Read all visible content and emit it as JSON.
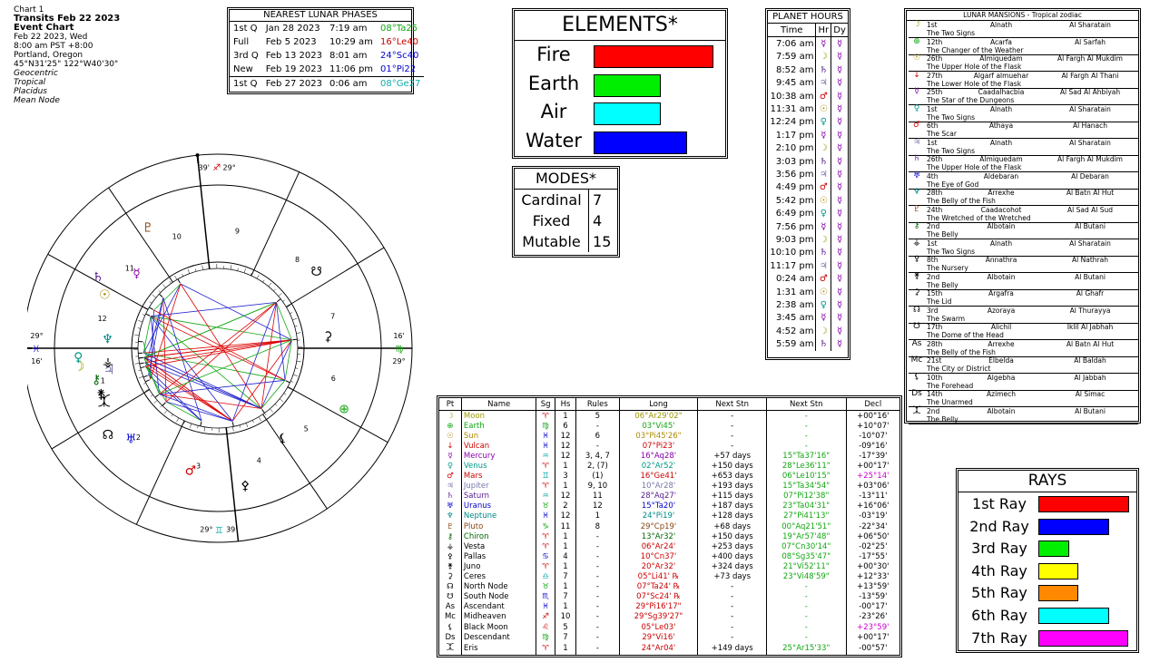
{
  "header": {
    "line1": "Chart 1",
    "title": "Transits Feb 22 2023",
    "subtitle": "Event Chart",
    "date": "Feb 22 2023, Wed",
    "time": "8:00 am  PST +8:00",
    "place": "Portland, Oregon",
    "coords": "45°N31'25\" 122°W40'30\"",
    "opt1": "Geocentric",
    "opt2": "Tropical",
    "opt3": "Placidus",
    "opt4": "Mean Node"
  },
  "phases": {
    "title": "NEAREST LUNAR PHASES",
    "rows": [
      {
        "phase": "1st Q",
        "date": "Jan 28 2023",
        "time": "7:19 am",
        "pos": "08°Ta25",
        "color": "#11a711"
      },
      {
        "phase": "Full",
        "date": "Feb 5 2023",
        "time": "10:29 am",
        "pos": "16°Le40",
        "color": "#cc0000"
      },
      {
        "phase": "3rd Q",
        "date": "Feb 13 2023",
        "time": "8:01 am",
        "pos": "24°Sc40",
        "color": "#0000cc"
      },
      {
        "phase": "New",
        "date": "Feb 19 2023",
        "time": "11:06 pm",
        "pos": "01°Pi22",
        "color": "#0000cc"
      },
      {
        "phase": "1st Q",
        "date": "Feb 27 2023",
        "time": "0:06 am",
        "pos": "08°Ge27",
        "color": "#11aaaa"
      }
    ]
  },
  "elements": {
    "title": "ELEMENTS*",
    "items": [
      {
        "name": "Fire",
        "value": 130,
        "color": "#ff0000"
      },
      {
        "name": "Earth",
        "value": 72,
        "color": "#00ee00"
      },
      {
        "name": "Air",
        "value": 72,
        "color": "#00ffff"
      },
      {
        "name": "Water",
        "value": 101,
        "color": "#0000ff"
      }
    ]
  },
  "modes": {
    "title": "MODES*",
    "items": [
      {
        "name": "Cardinal",
        "value": "7"
      },
      {
        "name": "Fixed",
        "value": "4"
      },
      {
        "name": "Mutable",
        "value": "15"
      }
    ]
  },
  "hours": {
    "title": "PLANET HOURS",
    "col_time": "Time",
    "col_hr": "Hr",
    "col_dy": "Dy",
    "rows": [
      {
        "t": "7:06 am",
        "h": "☿",
        "hc": "#8800aa"
      },
      {
        "t": "7:59 am",
        "h": "☽",
        "hc": "#999900"
      },
      {
        "t": "8:52 am",
        "h": "♄",
        "hc": "#551a8b"
      },
      {
        "t": "9:45 am",
        "h": "♃",
        "hc": "#7777aa"
      },
      {
        "t": "10:38 am",
        "h": "♂",
        "hc": "#cc0000"
      },
      {
        "t": "11:31 am",
        "h": "☉",
        "hc": "#aa8800"
      },
      {
        "t": "12:24 pm",
        "h": "♀",
        "hc": "#009988"
      },
      {
        "t": "1:17 pm",
        "h": "☿",
        "hc": "#8800aa"
      },
      {
        "t": "2:10 pm",
        "h": "☽",
        "hc": "#999900"
      },
      {
        "t": "3:03 pm",
        "h": "♄",
        "hc": "#551a8b"
      },
      {
        "t": "3:56 pm",
        "h": "♃",
        "hc": "#7777aa"
      },
      {
        "t": "4:49 pm",
        "h": "♂",
        "hc": "#cc0000"
      },
      {
        "t": "5:42 pm",
        "h": "☉",
        "hc": "#aa8800"
      },
      {
        "t": "6:49 pm",
        "h": "♀",
        "hc": "#009988"
      },
      {
        "t": "7:56 pm",
        "h": "☿",
        "hc": "#8800aa"
      },
      {
        "t": "9:03 pm",
        "h": "☽",
        "hc": "#999900"
      },
      {
        "t": "10:10 pm",
        "h": "♄",
        "hc": "#551a8b"
      },
      {
        "t": "11:17 pm",
        "h": "♃",
        "hc": "#7777aa"
      },
      {
        "t": "0:24 am",
        "h": "♂",
        "hc": "#cc0000"
      },
      {
        "t": "1:31 am",
        "h": "☉",
        "hc": "#aa8800"
      },
      {
        "t": "2:38 am",
        "h": "♀",
        "hc": "#009988"
      },
      {
        "t": "3:45 am",
        "h": "☿",
        "hc": "#8800aa"
      },
      {
        "t": "4:52 am",
        "h": "☽",
        "hc": "#999900"
      },
      {
        "t": "5:59 am",
        "h": "♄",
        "hc": "#551a8b"
      }
    ],
    "day_glyph": "☿",
    "day_color": "#8800aa"
  },
  "mansions": {
    "title": "LUNAR MANSIONS - Tropical zodiac",
    "rows": [
      {
        "g": "☽",
        "gc": "#999900",
        "n": "1st",
        "a": "Alnath",
        "b": "Al Sharatain",
        "d": "The Two Signs"
      },
      {
        "g": "⊕",
        "gc": "#11a711",
        "n": "12th",
        "a": "Acarfa",
        "b": "Al Sarfah",
        "d": "The Changer of the Weather"
      },
      {
        "g": "☉",
        "gc": "#aa8800",
        "n": "26th",
        "a": "Almiquedam",
        "b": "Al Fargh Al Mukdim",
        "d": "The Upper Hole of the Flask"
      },
      {
        "g": "↓",
        "gc": "#cc0000",
        "n": "27th",
        "a": "Algarf almuehar",
        "b": "Al Fargh Al Thani",
        "d": "The Lower Hole of the Flask"
      },
      {
        "g": "☿",
        "gc": "#8800aa",
        "n": "25th",
        "a": "Caadalhacbia",
        "b": "Al Sad Al Ahbiyah",
        "d": "The Star of the Dungeons"
      },
      {
        "g": "♀",
        "gc": "#009988",
        "n": "1st",
        "a": "Alnath",
        "b": "Al Sharatain",
        "d": "The Two Signs"
      },
      {
        "g": "♂",
        "gc": "#cc0000",
        "n": "6th",
        "a": "Athaya",
        "b": "Al Hanach",
        "d": "The Scar"
      },
      {
        "g": "♃",
        "gc": "#7777aa",
        "n": "1st",
        "a": "Alnath",
        "b": "Al Sharatain",
        "d": "The Two Signs"
      },
      {
        "g": "♄",
        "gc": "#551a8b",
        "n": "26th",
        "a": "Almiquedam",
        "b": "Al Fargh Al Mukdim",
        "d": "The Upper Hole of the Flask"
      },
      {
        "g": "♅",
        "gc": "#0000cc",
        "n": "4th",
        "a": "Aldebaran",
        "b": "Al Debaran",
        "d": "The Eye of God"
      },
      {
        "g": "♆",
        "gc": "#008888",
        "n": "28th",
        "a": "Arrexhe",
        "b": "Al Batn Al Hut",
        "d": "The Belly of the Fish"
      },
      {
        "g": "♇",
        "gc": "#8b4513",
        "n": "24th",
        "a": "Caadacohot",
        "b": "Al Sad Al Sud",
        "d": "The Wretched of the Wretched"
      },
      {
        "g": "⚷",
        "gc": "#006600",
        "n": "2nd",
        "a": "Albotain",
        "b": "Al Butani",
        "d": "The Belly"
      },
      {
        "g": "⚶",
        "gc": "#000000",
        "n": "1st",
        "a": "Alnath",
        "b": "Al Sharatain",
        "d": "The Two Signs"
      },
      {
        "g": "⚴",
        "gc": "#000000",
        "n": "8th",
        "a": "Annathra",
        "b": "Al Nathrah",
        "d": "The Nursery"
      },
      {
        "g": "⚵",
        "gc": "#000000",
        "n": "2nd",
        "a": "Albotain",
        "b": "Al Butani",
        "d": "The Belly"
      },
      {
        "g": "⚳",
        "gc": "#000000",
        "n": "15th",
        "a": "Argafra",
        "b": "Al Ghafr",
        "d": "The Lid"
      },
      {
        "g": "☊",
        "gc": "#000000",
        "n": "3rd",
        "a": "Azoraya",
        "b": "Al Thurayya",
        "d": "The Swarm"
      },
      {
        "g": "☋",
        "gc": "#000000",
        "n": "17th",
        "a": "Alichil",
        "b": "Iklil Al Jabhah",
        "d": "The Dome of the Head"
      },
      {
        "g": "As",
        "gc": "#000000",
        "n": "28th",
        "a": "Arrexhe",
        "b": "Al Batn Al Hut",
        "d": "The Belly of the Fish"
      },
      {
        "g": "Mc",
        "gc": "#000000",
        "n": "21st",
        "a": "Elbelda",
        "b": "Al Baldah",
        "d": "The City or District"
      },
      {
        "g": "⚸",
        "gc": "#000000",
        "n": "10th",
        "a": "Algebha",
        "b": "Al Jabbah",
        "d": "The Forehead"
      },
      {
        "g": "Ds",
        "gc": "#000000",
        "n": "14th",
        "a": "Azimech",
        "b": "Al Simac",
        "d": "The Unarmed"
      },
      {
        "g": "⯰",
        "gc": "#000000",
        "n": "2nd",
        "a": "Albotain",
        "b": "Al Butani",
        "d": "The Belly"
      }
    ]
  },
  "positions": {
    "headers": [
      "Pt",
      "Name",
      "Sg",
      "Hs",
      "Rules",
      "Long",
      "Next Stn",
      "Next Stn",
      "Decl"
    ],
    "rows": [
      {
        "g": "☽",
        "name": "Moon",
        "c": "#999900",
        "sg": "♈",
        "hs": "1",
        "ru": "5",
        "lon": "06°Ar29'02\"",
        "ns1": "-",
        "ns2": "-",
        "dec": "+00°16'",
        "dc": "#000"
      },
      {
        "g": "⊕",
        "name": "Earth",
        "c": "#11a711",
        "sg": "♍",
        "hs": "6",
        "ru": "-",
        "lon": "03°Vi45'",
        "ns1": "-",
        "ns2": "-",
        "dec": "+10°07'",
        "dc": "#000"
      },
      {
        "g": "☉",
        "name": "Sun",
        "c": "#aa8800",
        "sg": "♓",
        "hs": "12",
        "ru": "6",
        "lon": "03°Pi45'26\"",
        "ns1": "-",
        "ns2": "-",
        "dec": "-10°07'",
        "dc": "#000"
      },
      {
        "g": "↓",
        "name": "Vulcan",
        "c": "#cc0000",
        "sg": "♓",
        "hs": "12",
        "ru": "-",
        "lon": "07°Pi23'",
        "ns1": "-",
        "ns2": "-",
        "dec": "-09°16'",
        "dc": "#000"
      },
      {
        "g": "☿",
        "name": "Mercury",
        "c": "#8800aa",
        "sg": "♒",
        "hs": "12",
        "ru": "3, 4, 7",
        "lon": "16°Aq28'",
        "ns1": "+57 days",
        "ns2": "15°Ta37'16\"",
        "dec": "-17°39'",
        "dc": "#000"
      },
      {
        "g": "♀",
        "name": "Venus",
        "c": "#009988",
        "sg": "♈",
        "hs": "1",
        "ru": "2, (7)",
        "lon": "02°Ar52'",
        "ns1": "+150 days",
        "ns2": "28°Le36'11\"",
        "dec": "+00°17'",
        "dc": "#000"
      },
      {
        "g": "♂",
        "name": "Mars",
        "c": "#cc0000",
        "sg": "♊",
        "hs": "3",
        "ru": "(1)",
        "lon": "16°Ge41'",
        "ns1": "+653 days",
        "ns2": "06°Le10'15\"",
        "dec": "+25°14'",
        "dc": "#cc00cc"
      },
      {
        "g": "♃",
        "name": "Jupiter",
        "c": "#7777aa",
        "sg": "♈",
        "hs": "1",
        "ru": "9, 10",
        "lon": "10°Ar28'",
        "ns1": "+193 days",
        "ns2": "15°Ta34'54\"",
        "dec": "+03°06'",
        "dc": "#000"
      },
      {
        "g": "♄",
        "name": "Saturn",
        "c": "#551a8b",
        "sg": "♒",
        "hs": "12",
        "ru": "11",
        "lon": "28°Aq27'",
        "ns1": "+115 days",
        "ns2": "07°Pi12'38\"",
        "dec": "-13°11'",
        "dc": "#000"
      },
      {
        "g": "♅",
        "name": "Uranus",
        "c": "#0000cc",
        "sg": "♉",
        "hs": "2",
        "ru": "12",
        "lon": "15°Ta20'",
        "ns1": "+187 days",
        "ns2": "23°Ta04'31\"",
        "dec": "+16°06'",
        "dc": "#000"
      },
      {
        "g": "♆",
        "name": "Neptune",
        "c": "#008888",
        "sg": "♓",
        "hs": "12",
        "ru": "1",
        "lon": "24°Pi19'",
        "ns1": "+128 days",
        "ns2": "27°Pi41'13\"",
        "dec": "-03°19'",
        "dc": "#000"
      },
      {
        "g": "♇",
        "name": "Pluto",
        "c": "#8b4513",
        "sg": "♑",
        "hs": "11",
        "ru": "8",
        "lon": "29°Cp19'",
        "ns1": "+68 days",
        "ns2": "00°Aq21'51\"",
        "dec": "-22°34'",
        "dc": "#000"
      },
      {
        "g": "⚷",
        "name": "Chiron",
        "c": "#006600",
        "sg": "♈",
        "hs": "1",
        "ru": "-",
        "lon": "13°Ar32'",
        "ns1": "+150 days",
        "ns2": "19°Ar57'48\"",
        "dec": "+06°50'",
        "dc": "#000"
      },
      {
        "g": "⚶",
        "name": "Vesta",
        "c": "#000",
        "sg": "♈",
        "hs": "1",
        "ru": "-",
        "lon": "06°Ar24'",
        "ns1": "+253 days",
        "ns2": "07°Cn30'14\"",
        "dec": "-02°25'",
        "dc": "#000"
      },
      {
        "g": "⚴",
        "name": "Pallas",
        "c": "#000",
        "sg": "♋",
        "hs": "4",
        "ru": "-",
        "lon": "10°Cn37'",
        "ns1": "+400 days",
        "ns2": "08°Sg35'47\"",
        "dec": "-17°55'",
        "dc": "#000"
      },
      {
        "g": "⚵",
        "name": "Juno",
        "c": "#000",
        "sg": "♈",
        "hs": "1",
        "ru": "-",
        "lon": "20°Ar32'",
        "ns1": "+324 days",
        "ns2": "21°Vi52'11\"",
        "dec": "+00°30'",
        "dc": "#000"
      },
      {
        "g": "⚳",
        "name": "Ceres",
        "c": "#000",
        "sg": "♎",
        "hs": "7",
        "ru": "-",
        "lon": "05°Li41' ℞",
        "ns1": "+73 days",
        "ns2": "23°Vi48'59\"",
        "dec": "+12°33'",
        "dc": "#000"
      },
      {
        "g": "☊",
        "name": "North Node",
        "c": "#000",
        "sg": "♉",
        "hs": "1",
        "ru": "-",
        "lon": "07°Ta24' ℞",
        "ns1": "-",
        "ns2": "-",
        "dec": "+13°59'",
        "dc": "#000"
      },
      {
        "g": "☋",
        "name": "South Node",
        "c": "#000",
        "sg": "♏",
        "hs": "7",
        "ru": "-",
        "lon": "07°Sc24' ℞",
        "ns1": "-",
        "ns2": "-",
        "dec": "-13°59'",
        "dc": "#000"
      },
      {
        "g": "As",
        "name": "Ascendant",
        "c": "#000",
        "sg": "♓",
        "hs": "1",
        "ru": "-",
        "lon": "29°Pi16'17\"",
        "ns1": "-",
        "ns2": "-",
        "dec": "-00°17'",
        "dc": "#000"
      },
      {
        "g": "Mc",
        "name": "Midheaven",
        "c": "#000",
        "sg": "♐",
        "hs": "10",
        "ru": "-",
        "lon": "29°Sg39'27\"",
        "ns1": "-",
        "ns2": "-",
        "dec": "-23°26'",
        "dc": "#000"
      },
      {
        "g": "⚸",
        "name": "Black Moon",
        "c": "#000",
        "sg": "♌",
        "hs": "5",
        "ru": "-",
        "lon": "05°Le03'",
        "ns1": "-",
        "ns2": "-",
        "dec": "+23°59'",
        "dc": "#cc00cc"
      },
      {
        "g": "Ds",
        "name": "Descendant",
        "c": "#000",
        "sg": "♍",
        "hs": "7",
        "ru": "-",
        "lon": "29°Vi16'",
        "ns1": "-",
        "ns2": "-",
        "dec": "+00°17'",
        "dc": "#000"
      },
      {
        "g": "⯰",
        "name": "Eris",
        "c": "#000",
        "sg": "♈",
        "hs": "1",
        "ru": "-",
        "lon": "24°Ar04'",
        "ns1": "+149 days",
        "ns2": "25°Ar15'33\"",
        "dec": "-00°57'",
        "dc": "#000"
      }
    ]
  },
  "rays": {
    "title": "RAYS",
    "items": [
      {
        "name": "1st Ray",
        "value": 98,
        "color": "#ff0000"
      },
      {
        "name": "2nd Ray",
        "value": 76,
        "color": "#0000ff"
      },
      {
        "name": "3rd Ray",
        "value": 32,
        "color": "#00ee00"
      },
      {
        "name": "4th Ray",
        "value": 42,
        "color": "#ffff00"
      },
      {
        "name": "5th Ray",
        "value": 42,
        "color": "#ff8800"
      },
      {
        "name": "6th Ray",
        "value": 76,
        "color": "#00ffff"
      },
      {
        "name": "7th Ray",
        "value": 97,
        "color": "#ff00ff"
      }
    ]
  },
  "chart_data": {
    "type": "table",
    "wheel": {
      "ascendant_deg": 359.27,
      "cusps": [
        359.27,
        30.5,
        64.5,
        95.3,
        123.5,
        150.3,
        179.27,
        210.5,
        244.5,
        275.3,
        303.5,
        330.3
      ],
      "house_numbers": [
        "1",
        "2",
        "3",
        "4",
        "5",
        "6",
        "7",
        "8",
        "9",
        "10",
        "11",
        "12"
      ],
      "sign_glyphs": [
        "♈",
        "♉",
        "♊",
        "♋",
        "♌",
        "♍",
        "♎",
        "♏",
        "♐",
        "♑",
        "♒",
        "♓"
      ],
      "sign_colors": [
        "#cc0000",
        "#11a711",
        "#11aaaa",
        "#0000cc",
        "#cc0000",
        "#11a711",
        "#11aaaa",
        "#0000cc",
        "#cc0000",
        "#11a711",
        "#11aaaa",
        "#0000cc"
      ],
      "cusp_labels": [
        {
          "deg": "29°",
          "min": "16'",
          "sg": "♓",
          "lon": 359.27
        },
        {
          "deg": "29°",
          "min": "39'",
          "sg": "♐",
          "lon": 269.65
        },
        {
          "deg": "29°",
          "min": "16'",
          "sg": "♍",
          "lon": 179.27
        },
        {
          "deg": "29°",
          "min": "39'",
          "sg": "♊",
          "lon": 89.65
        }
      ],
      "planets": [
        {
          "g": "☽",
          "lon": 6.48,
          "c": "#999900"
        },
        {
          "g": "☉",
          "lon": 333.76,
          "c": "#aa8800"
        },
        {
          "g": "☿",
          "lon": 316.47,
          "c": "#8800aa"
        },
        {
          "g": "♀",
          "lon": 2.87,
          "c": "#009988"
        },
        {
          "g": "♂",
          "lon": 76.68,
          "c": "#cc0000"
        },
        {
          "g": "♃",
          "lon": 10.47,
          "c": "#7777aa"
        },
        {
          "g": "♄",
          "lon": 328.45,
          "c": "#551a8b"
        },
        {
          "g": "♅",
          "lon": 45.33,
          "c": "#0000cc"
        },
        {
          "g": "♆",
          "lon": 354.32,
          "c": "#008888"
        },
        {
          "g": "♇",
          "lon": 299.32,
          "c": "#8b4513"
        },
        {
          "g": "⚷",
          "lon": 13.53,
          "c": "#006600"
        },
        {
          "g": "⚶",
          "lon": 6.4,
          "c": "#000000"
        },
        {
          "g": "⚴",
          "lon": 100.62,
          "c": "#000000"
        },
        {
          "g": "⚵",
          "lon": 20.53,
          "c": "#000000"
        },
        {
          "g": "⚳",
          "lon": 185.68,
          "c": "#000000"
        },
        {
          "g": "☊",
          "lon": 37.4,
          "c": "#000000"
        },
        {
          "g": "☋",
          "lon": 217.4,
          "c": "#000000"
        },
        {
          "g": "⚸",
          "lon": 125.05,
          "c": "#000000"
        },
        {
          "g": "⊕",
          "lon": 153.76,
          "c": "#11a711"
        },
        {
          "g": "⯰",
          "lon": 24.07,
          "c": "#000000"
        }
      ]
    }
  }
}
